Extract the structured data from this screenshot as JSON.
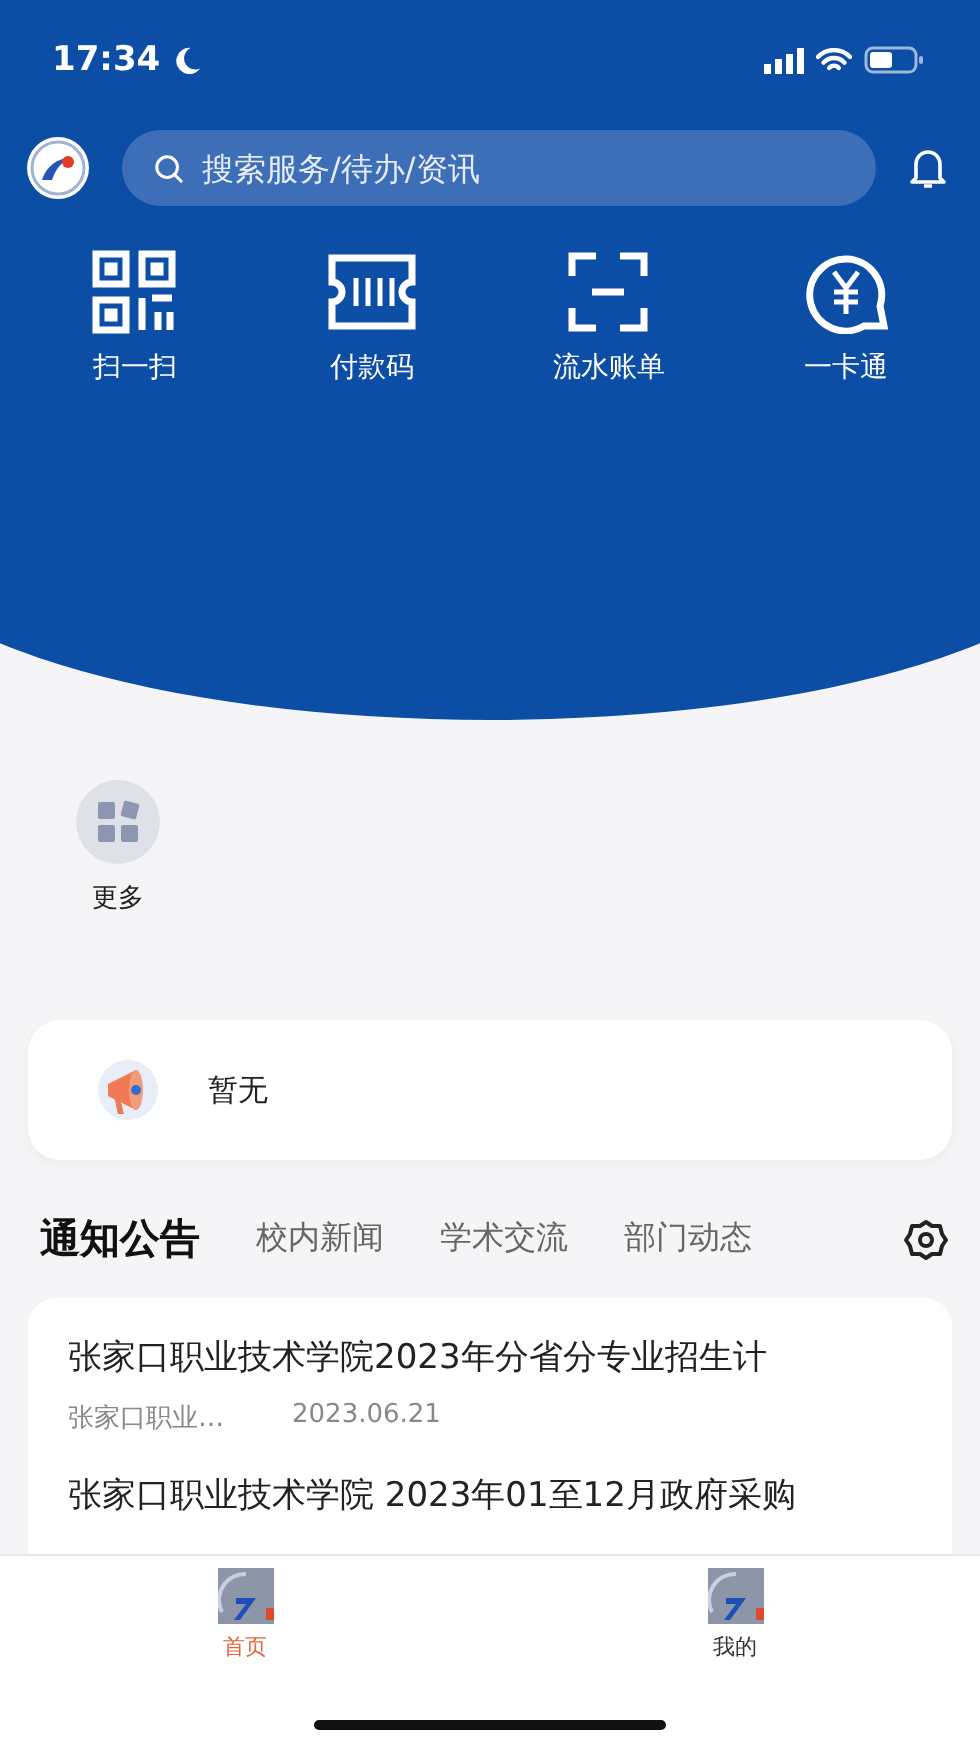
{
  "status_bar": {
    "time": "17:34"
  },
  "search": {
    "placeholder": "搜索服务/待办/资讯"
  },
  "quick_actions": [
    {
      "kind": "qr",
      "label": "扫一扫"
    },
    {
      "kind": "ticket",
      "label": "付款码"
    },
    {
      "kind": "scan",
      "label": "流水账单"
    },
    {
      "kind": "yen",
      "label": "一卡通"
    }
  ],
  "apps": [
    {
      "label": "更多"
    }
  ],
  "notice": {
    "text": "暂无"
  },
  "news_tabs": [
    {
      "label": "通知公告",
      "selected": true
    },
    {
      "label": "校内新闻",
      "selected": false
    },
    {
      "label": "学术交流",
      "selected": false
    },
    {
      "label": "部门动态",
      "selected": false
    }
  ],
  "news": [
    {
      "title": "张家口职业技术学院2023年分省分专业招生计",
      "source": "张家口职业…",
      "date": "2023.06.21"
    },
    {
      "title": "张家口职业技术学院 2023年01至12月政府采购"
    }
  ],
  "bottom_tabs": [
    {
      "label": "首页",
      "selected": true
    },
    {
      "label": "我的",
      "selected": false
    }
  ]
}
